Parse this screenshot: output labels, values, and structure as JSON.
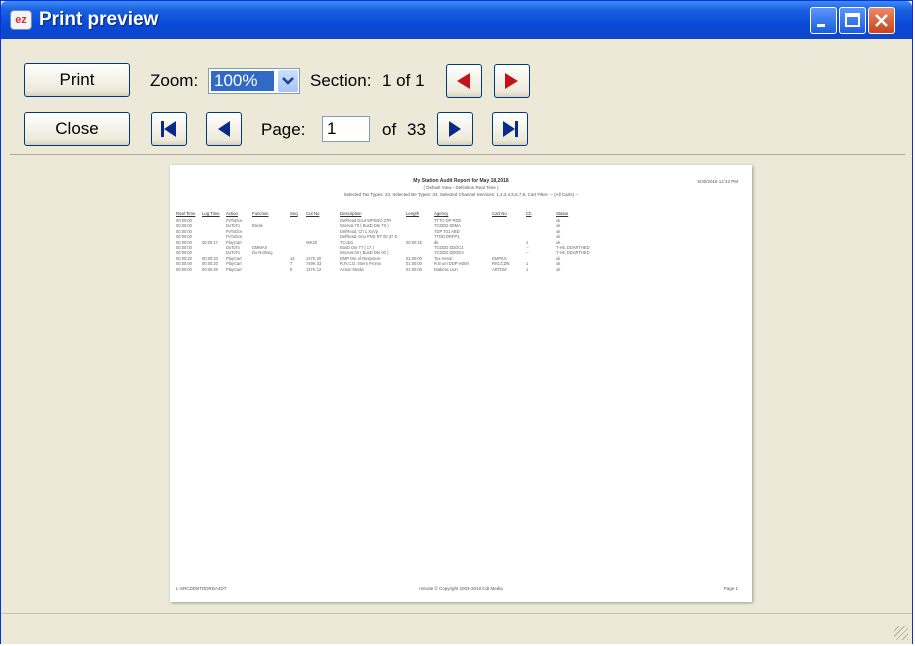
{
  "window": {
    "title": "Print preview",
    "app_icon": "ez"
  },
  "toolbar": {
    "print_label": "Print",
    "close_label": "Close",
    "zoom_label": "Zoom:",
    "zoom_value": "100%",
    "section_label": "Section:",
    "section_value": "1 of 1",
    "page_label": "Page:",
    "page_value": "1",
    "page_of": "of",
    "page_total": "33"
  },
  "report": {
    "title": "My Station Audit Report for May 18,2018",
    "subtitle": "( Default View - Definition Real Time )",
    "criteria": "Selected Tax Types: 23, Selected Be Types: 34, Selected Channel Services: 1,2,3,4,5,6,7,8, Cart Filter: -- (All Carts) --",
    "date": "5/30/2018 12:42 PM",
    "columns": [
      "Real Time",
      "Log Time",
      "Action",
      "Function",
      "Seq",
      "Cut No",
      "Description",
      "Length",
      "Agency",
      "Cart No",
      "Ch",
      "Status"
    ],
    "rows": [
      [
        "00:00:00",
        "",
        "PvToDce",
        "",
        "",
        "",
        "DefRead Dout WPSNO 37R",
        "",
        "TTTO DP RDD",
        "",
        "",
        "ok"
      ],
      [
        "00:00:00",
        "",
        "DoToTo",
        "Break",
        "",
        "",
        "Interval 70 ( BusD Dte T0 )",
        "",
        "TCDDD 8DMA",
        "",
        "",
        "ok"
      ],
      [
        "00:00:00",
        "",
        "PvToDce",
        "",
        "",
        "",
        "DefRead, Ch 1 XxVp",
        "",
        "TDP T01 ABD",
        "",
        "",
        "ok"
      ],
      [
        "00:00:00",
        "",
        "PvToDce",
        "",
        "",
        "",
        "DefRead, Dou PNS RT 00 37 D",
        "",
        "TTDD DRFP1",
        "",
        "",
        "ok"
      ],
      [
        "00:00:00",
        "00:00:17",
        "PlayCart",
        "",
        "",
        "WK20",
        "TCoDo",
        "00:00:15",
        "dk",
        "",
        "1",
        "ok"
      ],
      [
        "00:00:00",
        "",
        "DoToTo",
        "DMMAX",
        "",
        "",
        "BusD Dte T7 [ 17 ]",
        "",
        "TCDDD DDDC4",
        "",
        "--",
        "T-Hit, DDARTHED"
      ],
      [
        "00:00:00",
        "",
        "DoToTo",
        "Do Nothing",
        "",
        "",
        "Interval 00 ( BusD Dte 00 )",
        "",
        "TCDDD DDDES",
        "",
        "--",
        "T-Hit, DDARTHED"
      ],
      [
        "00:00:20",
        "00:00:20",
        "PlayCart",
        "",
        "14",
        "137K 20",
        "DMP Dte of Response",
        "01:00:00",
        "Tox Heroir",
        "DMPEX",
        "",
        "ok"
      ],
      [
        "00:00:00",
        "00:00:20",
        "PlayCart",
        "",
        "7",
        "749K 33",
        "R.R.C.D. Intern Promo",
        "01:00:00",
        "R.B um DDP HSMI",
        "RKCCDN",
        "1",
        "ok"
      ],
      [
        "00:00:00",
        "00:00:20",
        "PlayCart",
        "",
        "8",
        "137K 12",
        "Action Media",
        "01:00:00",
        "Diabetic Lion",
        "ARTDM",
        "1",
        "ok"
      ]
    ],
    "footer_left": "L-SRCDDNTDDRDA4DT",
    "footer_center": "mSuite © Copyright 2003-2018 Cdt Media",
    "footer_right": "Page 1"
  },
  "icons": {
    "prev_section": "triangle-left",
    "next_section": "triangle-right",
    "first_page": "first-page",
    "prev_page": "triangle-left",
    "next_page": "triangle-right",
    "last_page": "last-page"
  },
  "colors": {
    "titlebar": "#0a4ad8",
    "arrow_red": "#c4121a",
    "arrow_blue": "#0a2a8a",
    "selection": "#316ac5"
  }
}
